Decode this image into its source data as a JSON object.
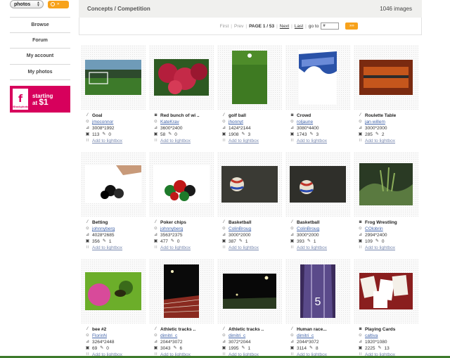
{
  "search": {
    "scope_value": "photos",
    "go_label": "»"
  },
  "sidebar": {
    "items": [
      {
        "label": "Browse",
        "name": "sidebar-item-browse"
      },
      {
        "label": "Forum",
        "name": "sidebar-item-forum"
      },
      {
        "label": "My account",
        "name": "sidebar-item-my-account"
      },
      {
        "label": "My photos",
        "name": "sidebar-item-my-photos"
      }
    ],
    "promo": {
      "brand": "iStockphoto",
      "line1": "starting",
      "line2_prefix": "at ",
      "price": "$1"
    }
  },
  "header": {
    "title": "Concepts / Competition",
    "count": "1046 images"
  },
  "pager": {
    "first": "First",
    "prev": "Prev",
    "page": "PAGE 1 / 53",
    "next": "Next",
    "last": "Last",
    "goto_label": "go to",
    "goto_value": "#",
    "go_label": "»»"
  },
  "photos": [
    {
      "title": "Goal",
      "user": "jmoconnor",
      "dims": "3008*1992",
      "views": "113",
      "comments": "0",
      "lightbox": "Add to lightbox",
      "type": "pencil"
    },
    {
      "title": "Red bunch of wi ..",
      "user": "KateKrav",
      "dims": "3600*2400",
      "views": "58",
      "comments": "0",
      "lightbox": "Add to lightbox",
      "type": "camera"
    },
    {
      "title": "golf ball",
      "user": "jhonnyt",
      "dims": "1424*2144",
      "views": "1908",
      "comments": "3",
      "lightbox": "Add to lightbox",
      "type": "pencil"
    },
    {
      "title": "Crowd",
      "user": "roljaune",
      "dims": "3080*4400",
      "views": "1743",
      "comments": "3",
      "lightbox": "Add to lightbox",
      "type": "camera"
    },
    {
      "title": "Roulette Table",
      "user": "jan-willem",
      "dims": "3000*2000",
      "views": "285",
      "comments": "2",
      "lightbox": "Add to lightbox",
      "type": "pencil"
    },
    {
      "title": "Betting",
      "user": "johnnyberg",
      "dims": "4028*2685",
      "views": "356",
      "comments": "1",
      "lightbox": "Add to lightbox",
      "type": "pencil"
    },
    {
      "title": "Poker chips",
      "user": "johnnyberg",
      "dims": "3563*2375",
      "views": "477",
      "comments": "0",
      "lightbox": "Add to lightbox",
      "type": "pencil"
    },
    {
      "title": "Basketball",
      "user": "ColinBroug",
      "dims": "3000*2000",
      "views": "387",
      "comments": "1",
      "lightbox": "Add to lightbox",
      "type": "pencil"
    },
    {
      "title": "Basketball",
      "user": "ColinBroug",
      "dims": "3000*2000",
      "views": "393",
      "comments": "1",
      "lightbox": "Add to lightbox",
      "type": "pencil"
    },
    {
      "title": "Frog Wrestling",
      "user": "COlobrin",
      "dims": "2994*2400",
      "views": "109",
      "comments": "0",
      "lightbox": "Add to lightbox",
      "type": "camera"
    },
    {
      "title": "bee #2",
      "user": "FlorinN",
      "dims": "3264*2448",
      "views": "69",
      "comments": "0",
      "lightbox": "Add to lightbox",
      "type": "pencil"
    },
    {
      "title": "Athletic tracks ..",
      "user": "dimitri_c",
      "dims": "2044*3072",
      "views": "3043",
      "comments": "6",
      "lightbox": "Add to lightbox",
      "type": "pencil"
    },
    {
      "title": "Athletic tracks ..",
      "user": "dimitri_c",
      "dims": "3072*2044",
      "views": "1995",
      "comments": "1",
      "lightbox": "Add to lightbox",
      "type": "pencil"
    },
    {
      "title": "Human race...",
      "user": "dimitri_c",
      "dims": "2044*3072",
      "views": "3114",
      "comments": "8",
      "lightbox": "Add to lightbox",
      "type": "pencil"
    },
    {
      "title": "Playing Cards",
      "user": "caltiva",
      "dims": "1920*1080",
      "views": "2225",
      "comments": "13",
      "lightbox": "Add to lightbox",
      "type": "camera"
    }
  ],
  "thumb_text": {
    "track_number": "5"
  }
}
